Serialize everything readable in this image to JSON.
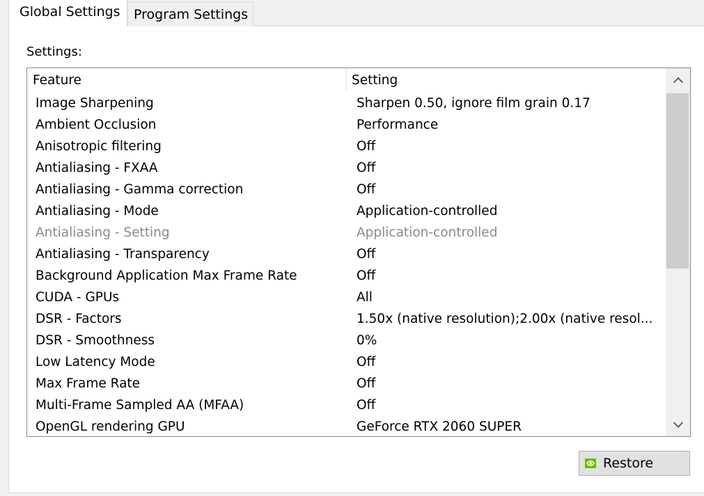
{
  "tabs": [
    {
      "label": "Global Settings",
      "selected": true
    },
    {
      "label": "Program Settings",
      "selected": false
    }
  ],
  "settings_label": "Settings:",
  "columns": {
    "feature": "Feature",
    "setting": "Setting"
  },
  "rows": [
    {
      "feature": "Image Sharpening",
      "setting": "Sharpen 0.50, ignore film grain 0.17"
    },
    {
      "feature": "Ambient Occlusion",
      "setting": "Performance"
    },
    {
      "feature": "Anisotropic filtering",
      "setting": "Off"
    },
    {
      "feature": "Antialiasing - FXAA",
      "setting": "Off"
    },
    {
      "feature": "Antialiasing - Gamma correction",
      "setting": "Off"
    },
    {
      "feature": "Antialiasing - Mode",
      "setting": "Application-controlled"
    },
    {
      "feature": "Antialiasing - Setting",
      "setting": "Application-controlled",
      "disabled": true
    },
    {
      "feature": "Antialiasing - Transparency",
      "setting": "Off"
    },
    {
      "feature": "Background Application Max Frame Rate",
      "setting": "Off"
    },
    {
      "feature": "CUDA - GPUs",
      "setting": "All"
    },
    {
      "feature": "DSR - Factors",
      "setting": "1.50x (native resolution);2.00x (native resol..."
    },
    {
      "feature": "DSR - Smoothness",
      "setting": "0%"
    },
    {
      "feature": "Low Latency Mode",
      "setting": "Off"
    },
    {
      "feature": "Max Frame Rate",
      "setting": "Off"
    },
    {
      "feature": "Multi-Frame Sampled AA (MFAA)",
      "setting": "Off"
    },
    {
      "feature": "OpenGL rendering GPU",
      "setting": "GeForce RTX 2060 SUPER"
    }
  ],
  "restore_button": {
    "label": "Restore",
    "icon": "nvidia-icon"
  },
  "colors": {
    "disabled_text": "#8a8a8a",
    "nvidia_green": "#76b900",
    "window_bg": "#f0f0f0"
  }
}
